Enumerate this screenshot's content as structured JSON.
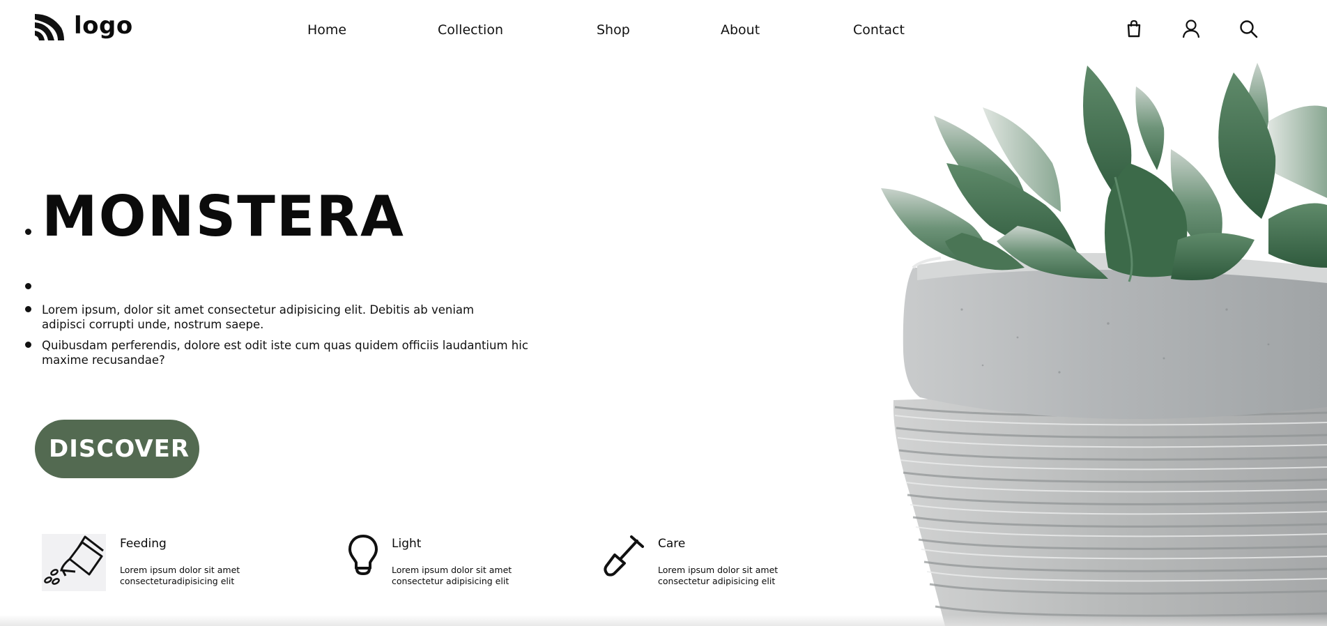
{
  "header": {
    "logo_text": "logo",
    "nav": [
      {
        "label": "Home"
      },
      {
        "label": "Collection"
      },
      {
        "label": "Shop"
      },
      {
        "label": "About"
      },
      {
        "label": "Contact"
      }
    ],
    "icons": [
      "shopping-bag-icon",
      "user-icon",
      "search-icon"
    ]
  },
  "hero": {
    "title": "MONSTERA",
    "paragraphs": [
      "Lorem ipsum, dolor sit amet consectetur adipisicing elit. Debitis ab veniam adipisci corrupti unde, nostrum saepe.",
      "Quibusdam perferendis, dolore est odit iste cum quas quidem officiis laudantium hic maxime recusandae?"
    ],
    "cta_label": "DISCOVER"
  },
  "features": [
    {
      "title": "Feeding",
      "text": "Lorem ipsum dolor sit amet consecteturadipisicing elit",
      "icon": "watering-can-icon"
    },
    {
      "title": "Light",
      "text": "Lorem ipsum dolor sit amet consectetur adipisicing elit",
      "icon": "light-bulb-icon"
    },
    {
      "title": "Care",
      "text": "Lorem ipsum dolor sit amet consectetur adipisicing elit",
      "icon": "shovel-icon"
    }
  ],
  "colors": {
    "accent": "#536a51",
    "text": "#0b0b0b",
    "background": "#ffffff"
  }
}
